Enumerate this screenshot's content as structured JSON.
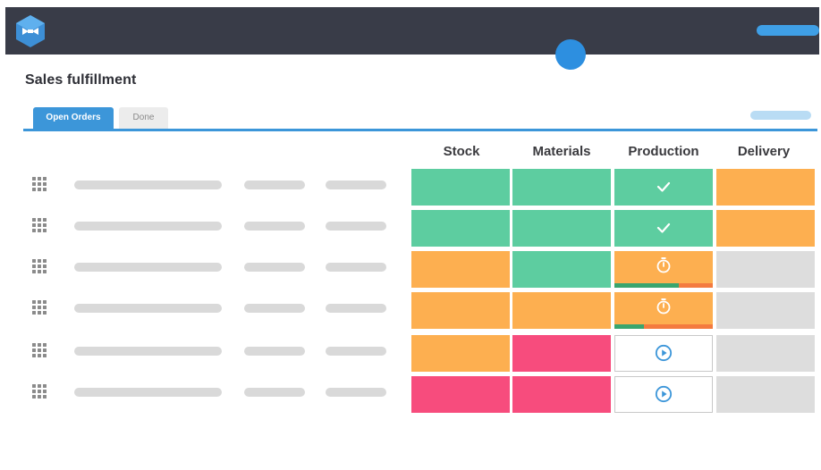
{
  "app": {
    "logo_icon": "blue-hexagon-bowtie-logo",
    "colors": {
      "topbar": "#393c48",
      "accent": "#3c96d9",
      "green": "#5dcda0",
      "orange": "#fdaf50",
      "pink": "#f74c7d",
      "grey": "#dddddd"
    }
  },
  "page": {
    "title": "Sales fulfillment"
  },
  "tabs": [
    {
      "label": "Open Orders",
      "active": true
    },
    {
      "label": "Done",
      "active": false
    }
  ],
  "table": {
    "columns": [
      "Stock",
      "Materials",
      "Production",
      "Delivery"
    ],
    "rows": [
      {
        "stock": "green",
        "materials": "green",
        "production": {
          "status": "green",
          "icon": "check-icon"
        },
        "delivery": "orange"
      },
      {
        "stock": "green",
        "materials": "green",
        "production": {
          "status": "green",
          "icon": "check-icon"
        },
        "delivery": "orange"
      },
      {
        "stock": "orange",
        "materials": "green",
        "production": {
          "status": "orange",
          "icon": "stopwatch-icon",
          "progress": 0.65
        },
        "delivery": "grey"
      },
      {
        "stock": "orange",
        "materials": "orange",
        "production": {
          "status": "orange",
          "icon": "stopwatch-icon",
          "progress": 0.3
        },
        "delivery": "grey"
      },
      {
        "stock": "orange",
        "materials": "pink",
        "production": {
          "status": "white",
          "icon": "play-icon"
        },
        "delivery": "grey"
      },
      {
        "stock": "pink",
        "materials": "pink",
        "production": {
          "status": "white",
          "icon": "play-icon"
        },
        "delivery": "grey"
      }
    ]
  }
}
